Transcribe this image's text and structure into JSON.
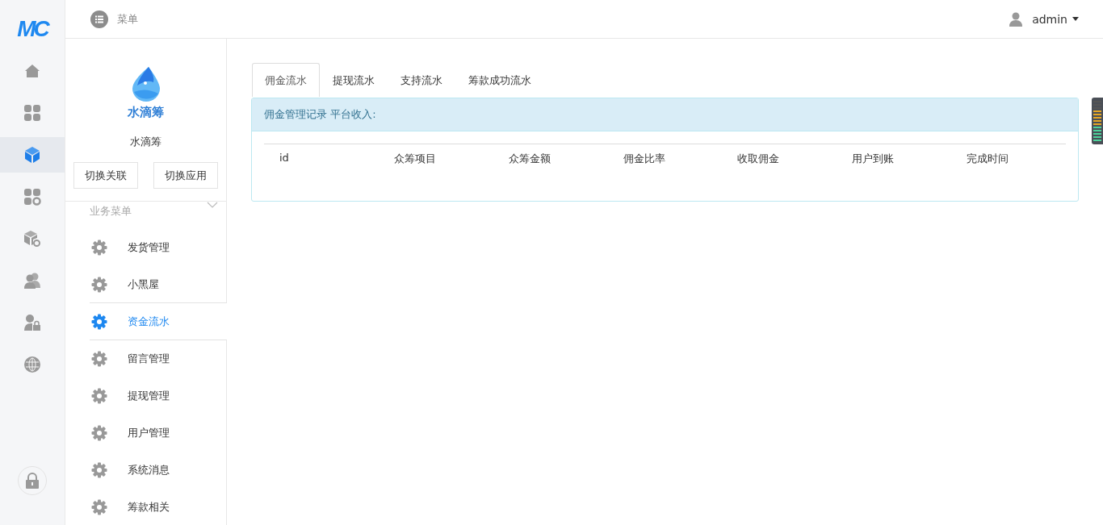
{
  "brand": {
    "logo": "MC"
  },
  "topbar": {
    "menu_label": "菜单",
    "user": "admin"
  },
  "rail": [
    {
      "kind": "home",
      "selected": false
    },
    {
      "kind": "grid",
      "selected": false
    },
    {
      "kind": "cube",
      "selected": true
    },
    {
      "kind": "grid-gear",
      "selected": false
    },
    {
      "kind": "box-gear",
      "selected": false
    },
    {
      "kind": "users",
      "selected": false
    },
    {
      "kind": "user-lock",
      "selected": false
    },
    {
      "kind": "globe",
      "selected": false
    }
  ],
  "app": {
    "logo_text": "水滴筹",
    "name": "水滴筹",
    "buttons": [
      "切换关联",
      "切换应用"
    ]
  },
  "menu": {
    "title": "业务菜单",
    "expanded": true,
    "items": [
      {
        "label": "发货管理",
        "selected": false
      },
      {
        "label": "小黑屋",
        "selected": false
      },
      {
        "label": "资金流水",
        "selected": true
      },
      {
        "label": "留言管理",
        "selected": false
      },
      {
        "label": "提现管理",
        "selected": false
      },
      {
        "label": "用户管理",
        "selected": false
      },
      {
        "label": "系统消息",
        "selected": false
      },
      {
        "label": "筹款相关",
        "selected": false
      }
    ]
  },
  "tabs": [
    {
      "label": "佣金流水",
      "selected": true
    },
    {
      "label": "提现流水",
      "selected": false
    },
    {
      "label": "支持流水",
      "selected": false
    },
    {
      "label": "筹款成功流水",
      "selected": false
    }
  ],
  "panel": {
    "heading": "佣金管理记录 平台收入:",
    "table": {
      "columns": [
        "id",
        "众筹项目",
        "众筹金额",
        "佣金比率",
        "收取佣金",
        "用户到账",
        "完成时间"
      ]
    }
  }
}
